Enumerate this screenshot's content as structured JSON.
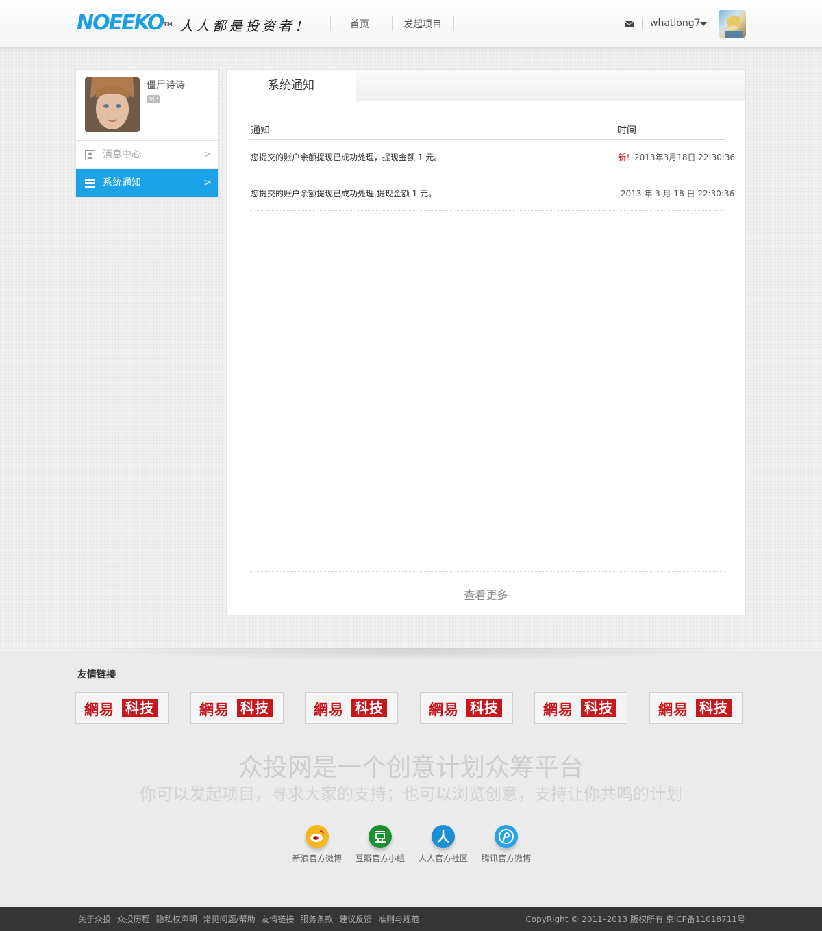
{
  "header": {
    "logo": "NOEEKO",
    "logo_tm": "TM",
    "slogan": "人人都是投资者！",
    "nav": [
      {
        "label": "首页"
      },
      {
        "label": "发起项目"
      }
    ],
    "username": "whatlong7"
  },
  "sidebar": {
    "profile_name": "僵尸诗诗",
    "vip_label": "VIP",
    "menu": [
      {
        "label": "消息中心",
        "arrow": ">",
        "active": false
      },
      {
        "label": "系统通知",
        "arrow": ">",
        "active": true
      }
    ],
    "active_color": "#1ba3e8"
  },
  "main": {
    "tab_label": "系统通知",
    "columns": {
      "notice": "通知",
      "time": "时间"
    },
    "rows": [
      {
        "message": "您提交的账户余额提现已成功处理，提现金额 1 元。",
        "new_flag": "新！",
        "time": "2013年3月18日 22:30:36"
      },
      {
        "message": "您提交的账户余额提现已成功处理,提现金额 1 元。",
        "new_flag": "",
        "time": "2013 年 3 月 18 日 22:30:36"
      }
    ],
    "more_label": "查看更多"
  },
  "footer": {
    "links_title": "友情链接",
    "friend_links": [
      {
        "name_a": "網易",
        "name_b": "科技"
      },
      {
        "name_a": "網易",
        "name_b": "科技"
      },
      {
        "name_a": "網易",
        "name_b": "科技"
      },
      {
        "name_a": "網易",
        "name_b": "科技"
      },
      {
        "name_a": "網易",
        "name_b": "科技"
      },
      {
        "name_a": "網易",
        "name_b": "科技"
      }
    ],
    "headline": "众投网是一个创意计划众筹平台",
    "subline": "你可以发起项目，寻求大家的支持；也可以浏览创意，支持让你共鸣的计划",
    "social": [
      {
        "label": "新浪官方微博",
        "icon": "weibo-icon",
        "color": "#f5b61e"
      },
      {
        "label": "豆瓣官方小组",
        "icon": "douban-icon",
        "color": "#1b9132"
      },
      {
        "label": "人人官方社区",
        "icon": "renren-icon",
        "color": "#1b8fd6"
      },
      {
        "label": "腾讯官方微博",
        "icon": "tencent-weibo-icon",
        "color": "#26a4e3"
      }
    ],
    "bottom_links": [
      "关于众投",
      "众投历程",
      "隐私权声明",
      "常见问题/帮助",
      "友情链接",
      "服务条款",
      "建议反馈",
      "准则与规范"
    ],
    "copyright": "CopyRight © 2011–2013    版权所有  京ICP备11018711号"
  }
}
